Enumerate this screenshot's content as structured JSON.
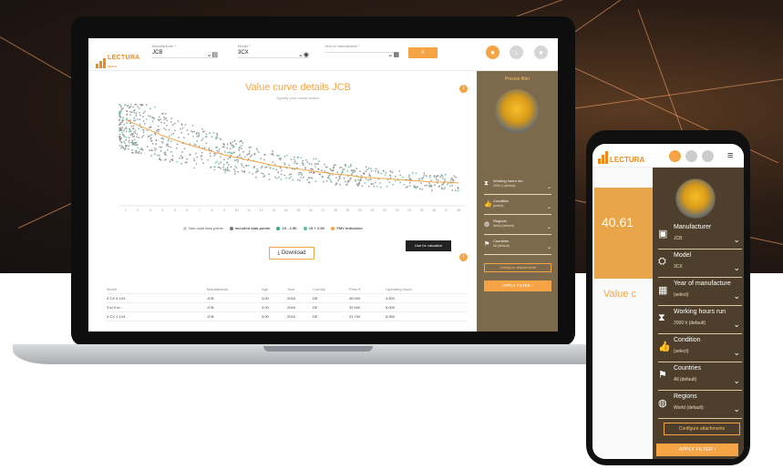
{
  "colors": {
    "accent": "#f5a445",
    "panel": "#7d6a4d",
    "phone_panel": "#4e3f2c"
  },
  "header": {
    "logo": "LECTURA",
    "logo_sub": "specs",
    "manufacturer_label": "Manufacturer *",
    "manufacturer_value": "JCB",
    "model_label": "Model *",
    "model_value": "3CX",
    "year_label": "Year of manufacture *",
    "year_value": ""
  },
  "chart": {
    "title": "Value curve details JCB",
    "subtitle": "Specify your model search",
    "legend": [
      "Non-valid data points",
      "Included data points",
      "15 - 2.5K",
      "15 + 2.5K",
      "FMV indication"
    ],
    "download": "Download",
    "tooltip_button": "Use for valuation"
  },
  "chart_data": {
    "type": "scatter",
    "title": "Value curve details JCB",
    "x": [
      1,
      2,
      3,
      4,
      5,
      6,
      7,
      8,
      9,
      10,
      11,
      12,
      13,
      14,
      15,
      16,
      17,
      18,
      19,
      20,
      21,
      22,
      23,
      24,
      25,
      26,
      27,
      28
    ],
    "series": [
      {
        "name": "FMV indication",
        "values": [
          98,
          92,
          86,
          80,
          75,
          70,
          66,
          62,
          58,
          55,
          52,
          49,
          46,
          44,
          42,
          40,
          38,
          36,
          35,
          33,
          32,
          31,
          30,
          29,
          28,
          27,
          27,
          26
        ]
      }
    ]
  },
  "table": {
    "headers": [
      "Model",
      "Manufacturer",
      "Age",
      "Year",
      "Country",
      "Price €",
      "Operating hours"
    ],
    "rows": [
      [
        "3 CX 4 1X4",
        "JCB",
        "3,00",
        "2018",
        "DE",
        "45,000",
        "3,500"
      ],
      [
        "3 to 5 m...",
        "JCB",
        "3,00",
        "2016",
        "DE",
        "32,000",
        "8,000"
      ],
      [
        "3 CX 1 1X4",
        "JCB",
        "3,00",
        "2016",
        "DE",
        "31,700",
        "6,950"
      ]
    ]
  },
  "panel": {
    "title": "Precise filter",
    "filters": [
      {
        "icon": "hourglass-icon",
        "label": "Working hours run",
        "value": "2000 h (default)"
      },
      {
        "icon": "thumbs-up-icon",
        "label": "Condition",
        "value": "(select)"
      },
      {
        "icon": "globe-icon",
        "label": "Regions",
        "value": "World (default)"
      },
      {
        "icon": "flag-icon",
        "label": "Countries",
        "value": "All (default)"
      }
    ],
    "attach": "Configure attachments",
    "apply": "APPLY FILTER"
  },
  "phone": {
    "logo": "LECTURA",
    "price": "40.61",
    "value_curve": "Value c",
    "filters": [
      {
        "icon": "id-card-icon",
        "label": "Manufacturer",
        "value": "JCB"
      },
      {
        "icon": "excavator-icon",
        "label": "Model",
        "value": "3CX"
      },
      {
        "icon": "calendar-icon",
        "label": "Year of manufacture",
        "value": "(select)"
      },
      {
        "icon": "hourglass-icon",
        "label": "Working hours run",
        "value": "2000 h (default)"
      },
      {
        "icon": "thumbs-up-icon",
        "label": "Condition",
        "value": "(select)"
      },
      {
        "icon": "flag-icon",
        "label": "Countries",
        "value": "All (default)"
      },
      {
        "icon": "globe-icon",
        "label": "Regions",
        "value": "World (default)"
      }
    ],
    "attach": "Configure attachments",
    "apply": "APPLY FILTER"
  }
}
